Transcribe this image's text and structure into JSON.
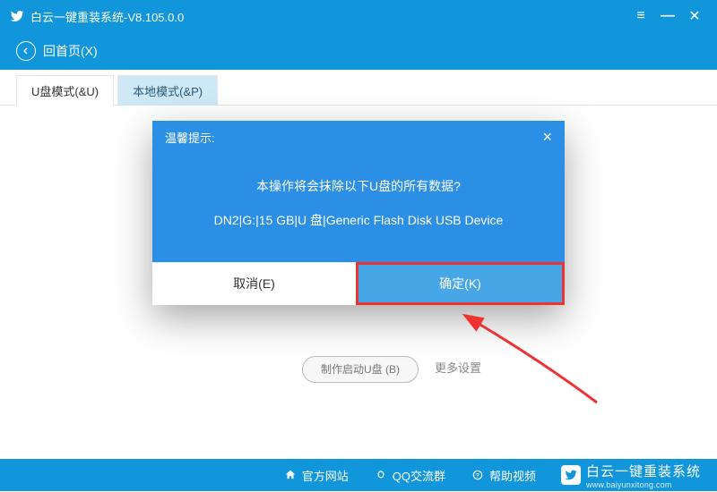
{
  "titlebar": {
    "title": "白云一键重装系统-V8.105.0.0"
  },
  "nav": {
    "back_label": "回首页(X)"
  },
  "tabs": [
    {
      "label": "U盘模式(&U)",
      "active": true
    },
    {
      "label": "本地模式(&P)",
      "active": false
    }
  ],
  "backdrop": {
    "make_btn": "制作启动U盘 (B)",
    "more": "更多设置"
  },
  "dialog": {
    "header": "温馨提示:",
    "line1": "本操作将会抹除以下U盘的所有数据?",
    "line2": "DN2|G:|15 GB|U 盘|Generic Flash Disk USB Device",
    "cancel": "取消(E)",
    "ok": "确定(K)"
  },
  "footer": {
    "site": "官方网站",
    "qq": "QQ交流群",
    "help": "帮助视频",
    "brand": "白云一键重装系统",
    "brand_url": "www.baiyunxitong.com"
  }
}
